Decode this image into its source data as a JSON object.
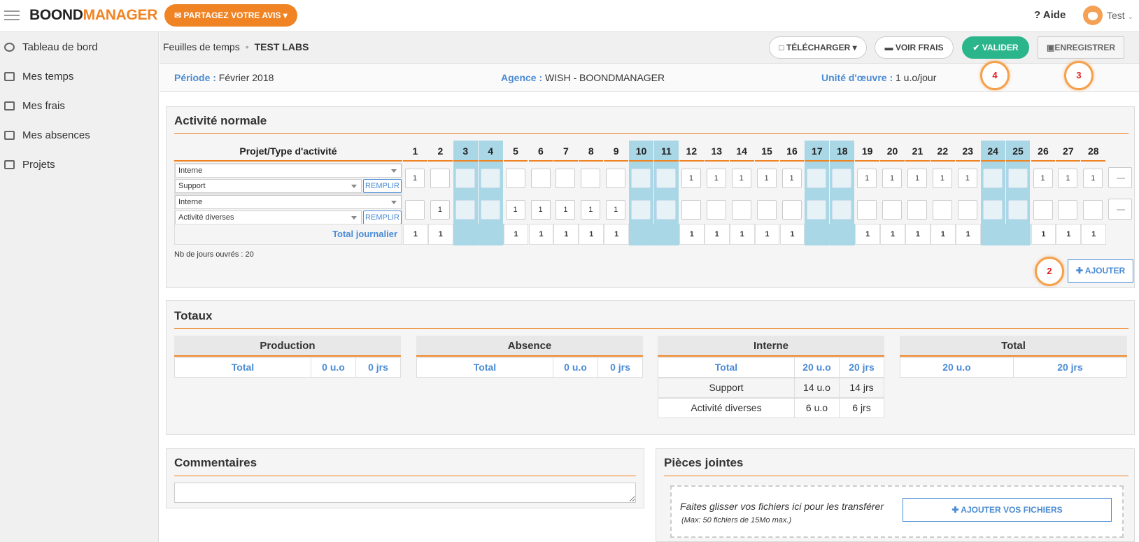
{
  "header": {
    "logo_part1": "BOOND",
    "logo_part2": "MANAGER",
    "feedback_button": "PARTAGEZ VOTRE AVIS",
    "help": "Aide",
    "user": "Test"
  },
  "sidebar": {
    "items": [
      {
        "label": "Tableau de bord"
      },
      {
        "label": "Mes temps"
      },
      {
        "label": "Mes frais"
      },
      {
        "label": "Mes absences"
      },
      {
        "label": "Projets"
      }
    ]
  },
  "toolbar": {
    "breadcrumb_1": "Feuilles de temps",
    "breadcrumb_2": "TEST LABS",
    "download": "TÉLÉCHARGER",
    "view_expenses": "VOIR FRAIS",
    "validate": "VALIDER",
    "save": "ENREGISTRER"
  },
  "info": {
    "period_label": "Période :",
    "period_value": "Février 2018",
    "agency_label": "Agence :",
    "agency_value": "WISH - BOONDMANAGER",
    "unit_label": "Unité d'œuvre :",
    "unit_value": "1 u.o/jour"
  },
  "annotations": [
    "4",
    "3",
    "2"
  ],
  "activity": {
    "title": "Activité normale",
    "project_header": "Projet/Type d'activité",
    "days": [
      "1",
      "2",
      "3",
      "4",
      "5",
      "6",
      "7",
      "8",
      "9",
      "10",
      "11",
      "12",
      "13",
      "14",
      "15",
      "16",
      "17",
      "18",
      "19",
      "20",
      "21",
      "22",
      "23",
      "24",
      "25",
      "26",
      "27",
      "28"
    ],
    "weekend_days": [
      "3",
      "4",
      "10",
      "11",
      "17",
      "18",
      "24",
      "25"
    ],
    "rows": [
      {
        "category": "Interne",
        "activity": "Support",
        "fill_button": "REMPLIR",
        "values": [
          "1",
          "",
          "",
          "",
          "",
          "",
          "",
          "",
          "",
          "",
          "",
          "1",
          "1",
          "1",
          "1",
          "1",
          "",
          "",
          "1",
          "1",
          "1",
          "1",
          "1",
          "",
          "",
          "1",
          "1",
          "1"
        ]
      },
      {
        "category": "Interne",
        "activity": "Activité diverses",
        "fill_button": "REMPLIR",
        "values": [
          "",
          "1",
          "",
          "",
          "1",
          "1",
          "1",
          "1",
          "1",
          "",
          "",
          "",
          "",
          "",
          "",
          "",
          "",
          "",
          "",
          "",
          "",
          "",
          "",
          "",
          "",
          "",
          "",
          ""
        ]
      }
    ],
    "total_label": "Total journalier",
    "totals": [
      "1",
      "1",
      "",
      "",
      "1",
      "1",
      "1",
      "1",
      "1",
      "",
      "",
      "1",
      "1",
      "1",
      "1",
      "1",
      "",
      "",
      "1",
      "1",
      "1",
      "1",
      "1",
      "",
      "",
      "1",
      "1",
      "1"
    ],
    "working_days": "Nb de jours ouvrés : 20",
    "add_button": "AJOUTER"
  },
  "totals": {
    "title": "Totaux",
    "production": {
      "header": "Production",
      "total": "Total",
      "uo": "0 u.o",
      "days": "0 jrs"
    },
    "absence": {
      "header": "Absence",
      "total": "Total",
      "uo": "0 u.o",
      "days": "0 jrs"
    },
    "interne": {
      "header": "Interne",
      "total": "Total",
      "uo": "20 u.o",
      "days": "20 jrs",
      "rows": [
        {
          "name": "Support",
          "uo": "14 u.o",
          "days": "14 jrs"
        },
        {
          "name": "Activité diverses",
          "uo": "6 u.o",
          "days": "6 jrs"
        }
      ]
    },
    "total": {
      "header": "Total",
      "uo": "20 u.o",
      "days": "20 jrs"
    }
  },
  "comments": {
    "title": "Commentaires"
  },
  "attachments": {
    "title": "Pièces jointes",
    "drop_text": "Faites glisser vos fichiers ici pour les transférer",
    "drop_sub": "(Max: 50 fichiers de 15Mo max.)",
    "add_files": "AJOUTER VOS FICHIERS"
  },
  "colors": {
    "accent": "#f08323",
    "link": "#4a8bd4",
    "green": "#2bb58a",
    "weekend": "#a9d7e6"
  }
}
